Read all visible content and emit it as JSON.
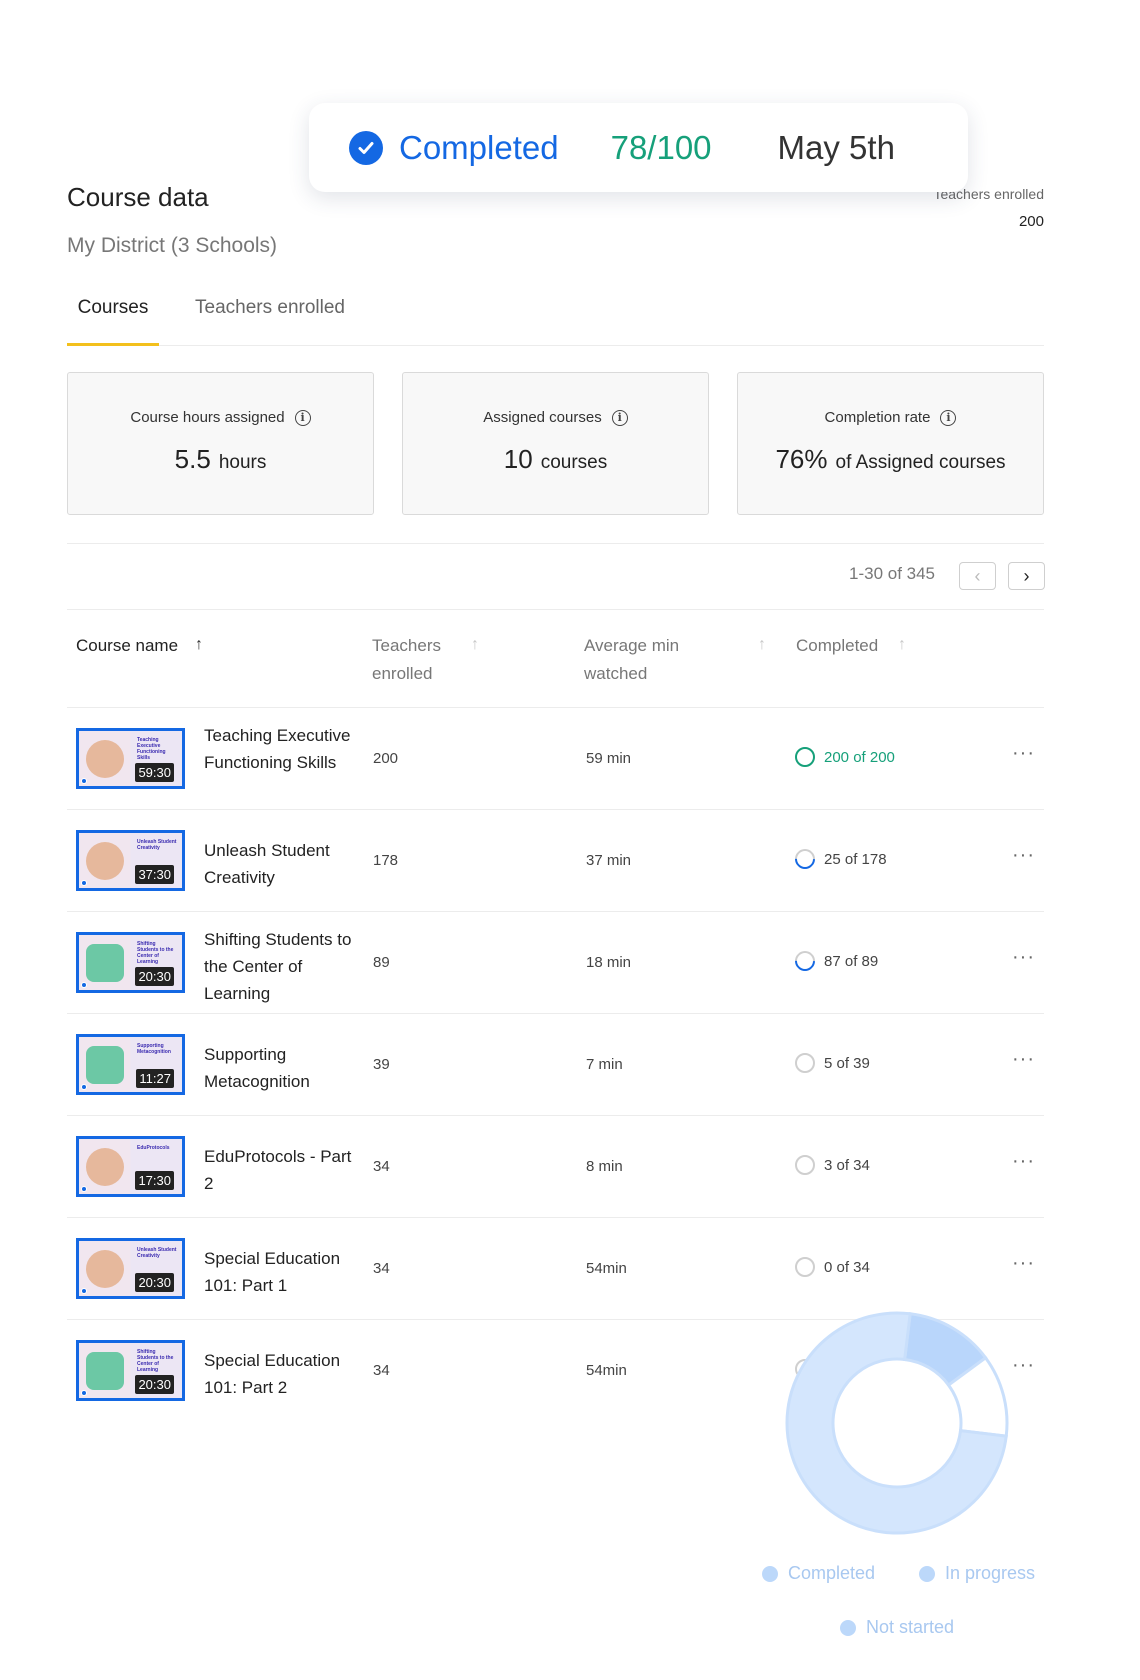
{
  "toast": {
    "status": "Completed",
    "score": "78/100",
    "date": "May 5th"
  },
  "top_right": {
    "label": "Teachers enrolled",
    "value": "200"
  },
  "header": {
    "title": "Course data",
    "subtitle": "My District (3 Schools)"
  },
  "tabs": [
    {
      "label": "Courses",
      "active": true
    },
    {
      "label": "Teachers enrolled",
      "active": false
    }
  ],
  "stats": [
    {
      "label": "Course hours assigned",
      "value": "5.5",
      "unit": "hours"
    },
    {
      "label": "Assigned courses",
      "value": "10",
      "unit": "courses"
    },
    {
      "label": "Completion rate",
      "value": "76%",
      "unit": "of Assigned courses"
    }
  ],
  "pagination": {
    "text": "1-30 of 345",
    "prev_icon": "chevron-left-icon",
    "next_icon": "chevron-right-icon"
  },
  "table": {
    "columns": [
      {
        "label": "Course name"
      },
      {
        "label": "Teachers enrolled"
      },
      {
        "label": "Average min watched"
      },
      {
        "label": "Completed"
      }
    ],
    "rows": [
      {
        "name": "Teaching Executive Functioning Skills",
        "thumb_text": "Teaching Executive Functioning Skills",
        "duration": "59:30",
        "enrolled": "200",
        "avg": "59 min",
        "completed": "200 of 200",
        "status": "complete"
      },
      {
        "name": "Unleash Student Creativity",
        "thumb_text": "Unleash Student Creativity",
        "duration": "37:30",
        "enrolled": "178",
        "avg": "37 min",
        "completed": "25 of 178",
        "status": "partial"
      },
      {
        "name": "Shifting Students to the Center of Learning",
        "thumb_text": "Shifting Students to the Center of Learning",
        "duration": "20:30",
        "enrolled": "89",
        "avg": "18 min",
        "completed": "87 of 89",
        "status": "partial"
      },
      {
        "name": "Supporting Metacognition",
        "thumb_text": "Supporting Metacognition",
        "duration": "11:27",
        "enrolled": "39",
        "avg": "7 min",
        "completed": "5 of 39",
        "status": "none"
      },
      {
        "name": "EduProtocols - Part 2",
        "thumb_text": "EduProtocols",
        "duration": "17:30",
        "enrolled": "34",
        "avg": "8 min",
        "completed": "3 of 34",
        "status": "none"
      },
      {
        "name": "Special Education 101: Part 1",
        "thumb_text": "Unleash Student Creativity",
        "duration": "20:30",
        "enrolled": "34",
        "avg": "54min",
        "completed": "0 of 34",
        "status": "none"
      },
      {
        "name": "Special Education 101: Part 2",
        "thumb_text": "Shifting Students to the Center of Learning",
        "duration": "20:30",
        "enrolled": "34",
        "avg": "54min",
        "completed": "",
        "status": "none"
      }
    ]
  },
  "donut": {
    "legend": [
      "Completed",
      "In progress",
      "Not started"
    ],
    "segments": [
      {
        "name": "Completed",
        "fraction": 0.75,
        "color": "#d4e6fd"
      },
      {
        "name": "In progress",
        "fraction": 0.13,
        "color": "#b9d6fb"
      },
      {
        "name": "Not started",
        "fraction": 0.12,
        "color": "#ffffff"
      }
    ]
  },
  "colors": {
    "accent": "#1468e3",
    "success": "#16a07a",
    "tab_underline": "#f3c01c"
  }
}
